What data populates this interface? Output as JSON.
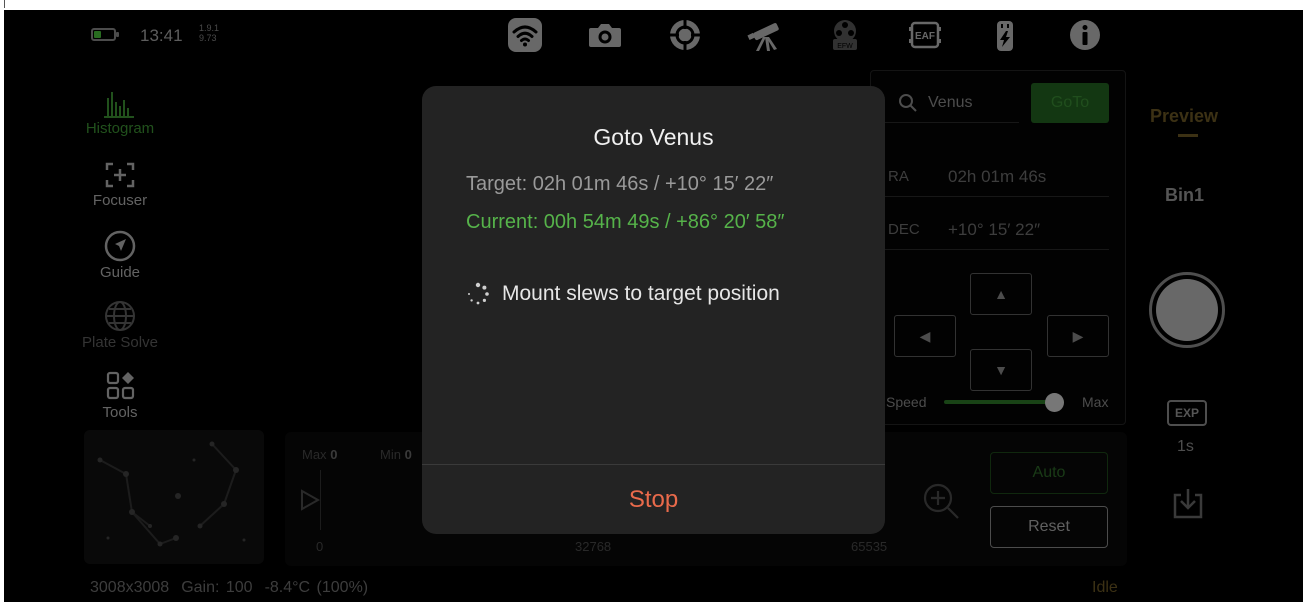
{
  "status_bar": {
    "time": "13:41",
    "version_line1": "1.9.1",
    "version_line2": "9.73",
    "battery_level": 0.35,
    "battery_color": "#49c53b"
  },
  "top_icons": [
    "wifi-icon",
    "camera-icon",
    "crosshair-icon",
    "telescope-icon",
    "efw-icon",
    "eaf-icon",
    "power-bank-icon",
    "info-icon"
  ],
  "top_icon_labels": {
    "efw": "EFW",
    "eaf": "EAF"
  },
  "left_menu": {
    "histogram": "Histogram",
    "focuser": "Focuser",
    "guide": "Guide",
    "plate_solve": "Plate Solve",
    "tools": "Tools"
  },
  "goto_panel": {
    "search_value": "Venus",
    "goto_label": "GoTo",
    "ra_label": "RA",
    "ra_value": "02h 01m 46s",
    "dec_label": "DEC",
    "dec_value": "+10° 15′ 22″",
    "speed_label": "Speed",
    "speed_max_label": "Max",
    "speed_level": 0.92
  },
  "right_column": {
    "preview_label": "Preview",
    "bin_label": "Bin1",
    "exp_label": "EXP",
    "exp_value": "1s"
  },
  "histogram": {
    "max_label": "Max",
    "max_value": "0",
    "min_label": "Min",
    "min_value": "0",
    "axis_start": "0",
    "axis_mid": "32768",
    "axis_end": "65535",
    "auto_label": "Auto",
    "reset_label": "Reset"
  },
  "footer": {
    "resolution": "3008x3008",
    "gain": "Gain: 100",
    "temperature": "-8.4°C (100%)",
    "state": "Idle"
  },
  "dialog": {
    "title": "Goto Venus",
    "target": "Target: 02h 01m 46s / +10° 15′ 22″",
    "current": "Current: 00h 54m 49s / +86° 20′ 58″",
    "status": "Mount slews to target position",
    "stop_label": "Stop"
  },
  "colors": {
    "accent_green": "#3d9434",
    "current_green": "#56b34a",
    "stop_red": "#e96a4b",
    "preview_gold": "#6e5a26",
    "dialog_bg": "#232323"
  }
}
